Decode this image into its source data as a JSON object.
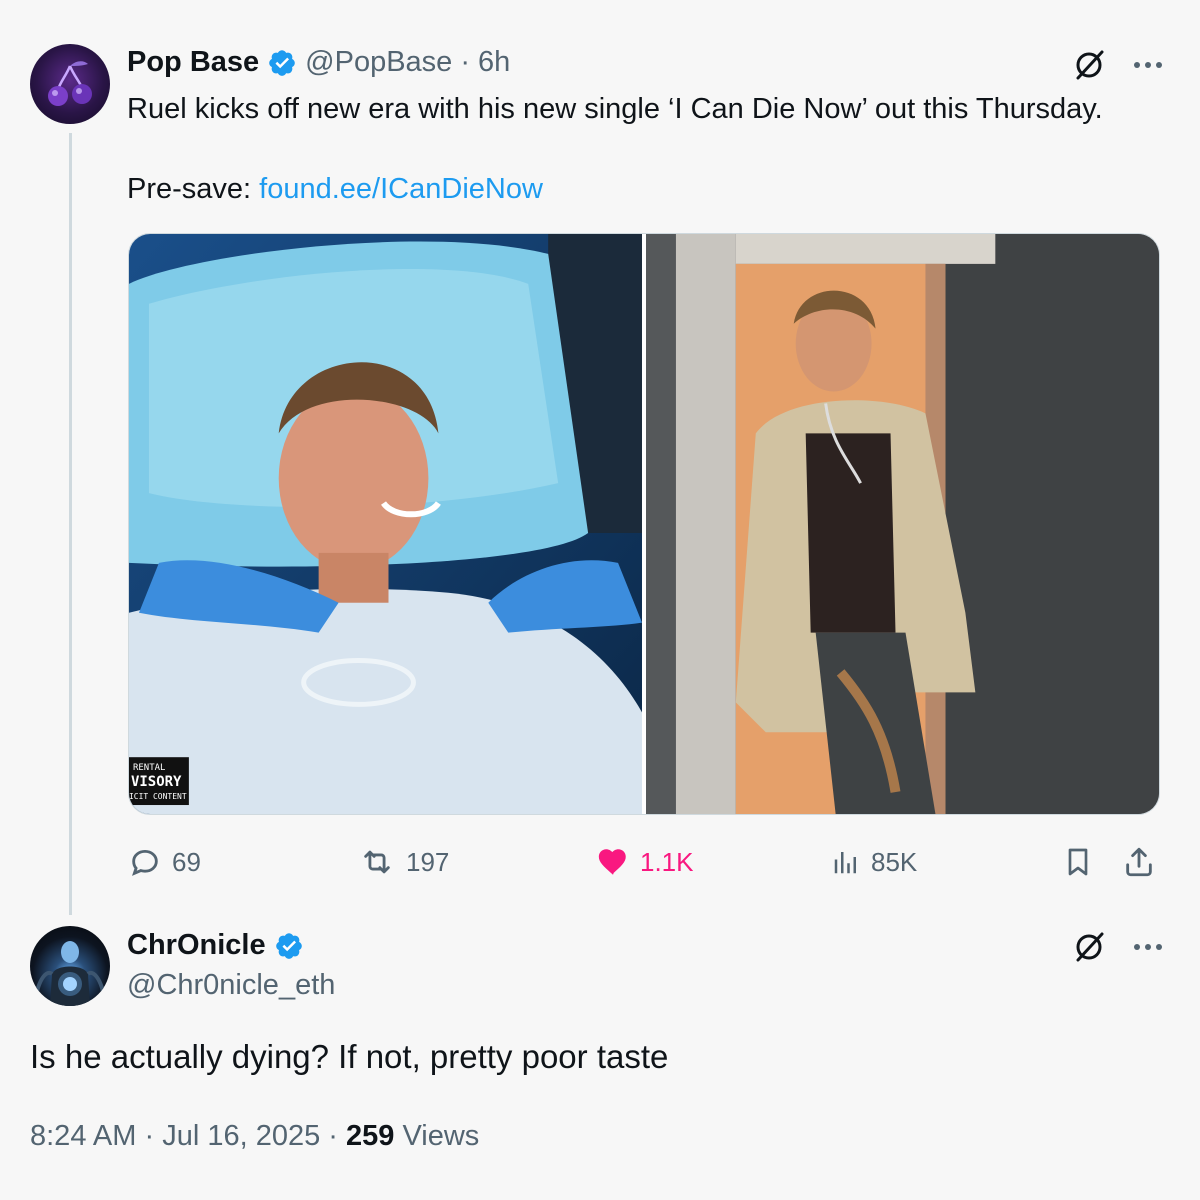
{
  "original_tweet": {
    "author_name": "Pop Base",
    "handle": "@PopBase",
    "separator": "·",
    "time": "6h",
    "text_line1": "Ruel kicks off new era with his new single ‘I Can Die Now’ out this Thursday.",
    "presave_label": "Pre-save: ",
    "presave_link": "found.ee/ICanDieNow",
    "media_badge_line1": "RENTAL",
    "media_badge_line2": "VISORY",
    "media_badge_line3": "ICIT CONTENT",
    "stats": {
      "replies": "69",
      "reposts": "197",
      "likes": "1.1K",
      "views": "85K"
    }
  },
  "reply_tweet": {
    "author_name": "ChrOnicle",
    "handle": "@Chr0nicle_eth",
    "text": "Is he actually dying? If not, pretty poor taste",
    "time": "8:24 AM",
    "date": "Jul 16, 2025",
    "separator": "·",
    "views_count": "259",
    "views_label": "Views"
  },
  "colors": {
    "accent": "#1d9bf0",
    "like": "#f91880",
    "secondary_text": "#536471",
    "background": "#f7f7f7"
  },
  "icons": [
    "verified-icon",
    "grok-icon",
    "more-icon",
    "reply-icon",
    "repost-icon",
    "like-icon",
    "views-icon",
    "bookmark-icon",
    "share-icon"
  ]
}
